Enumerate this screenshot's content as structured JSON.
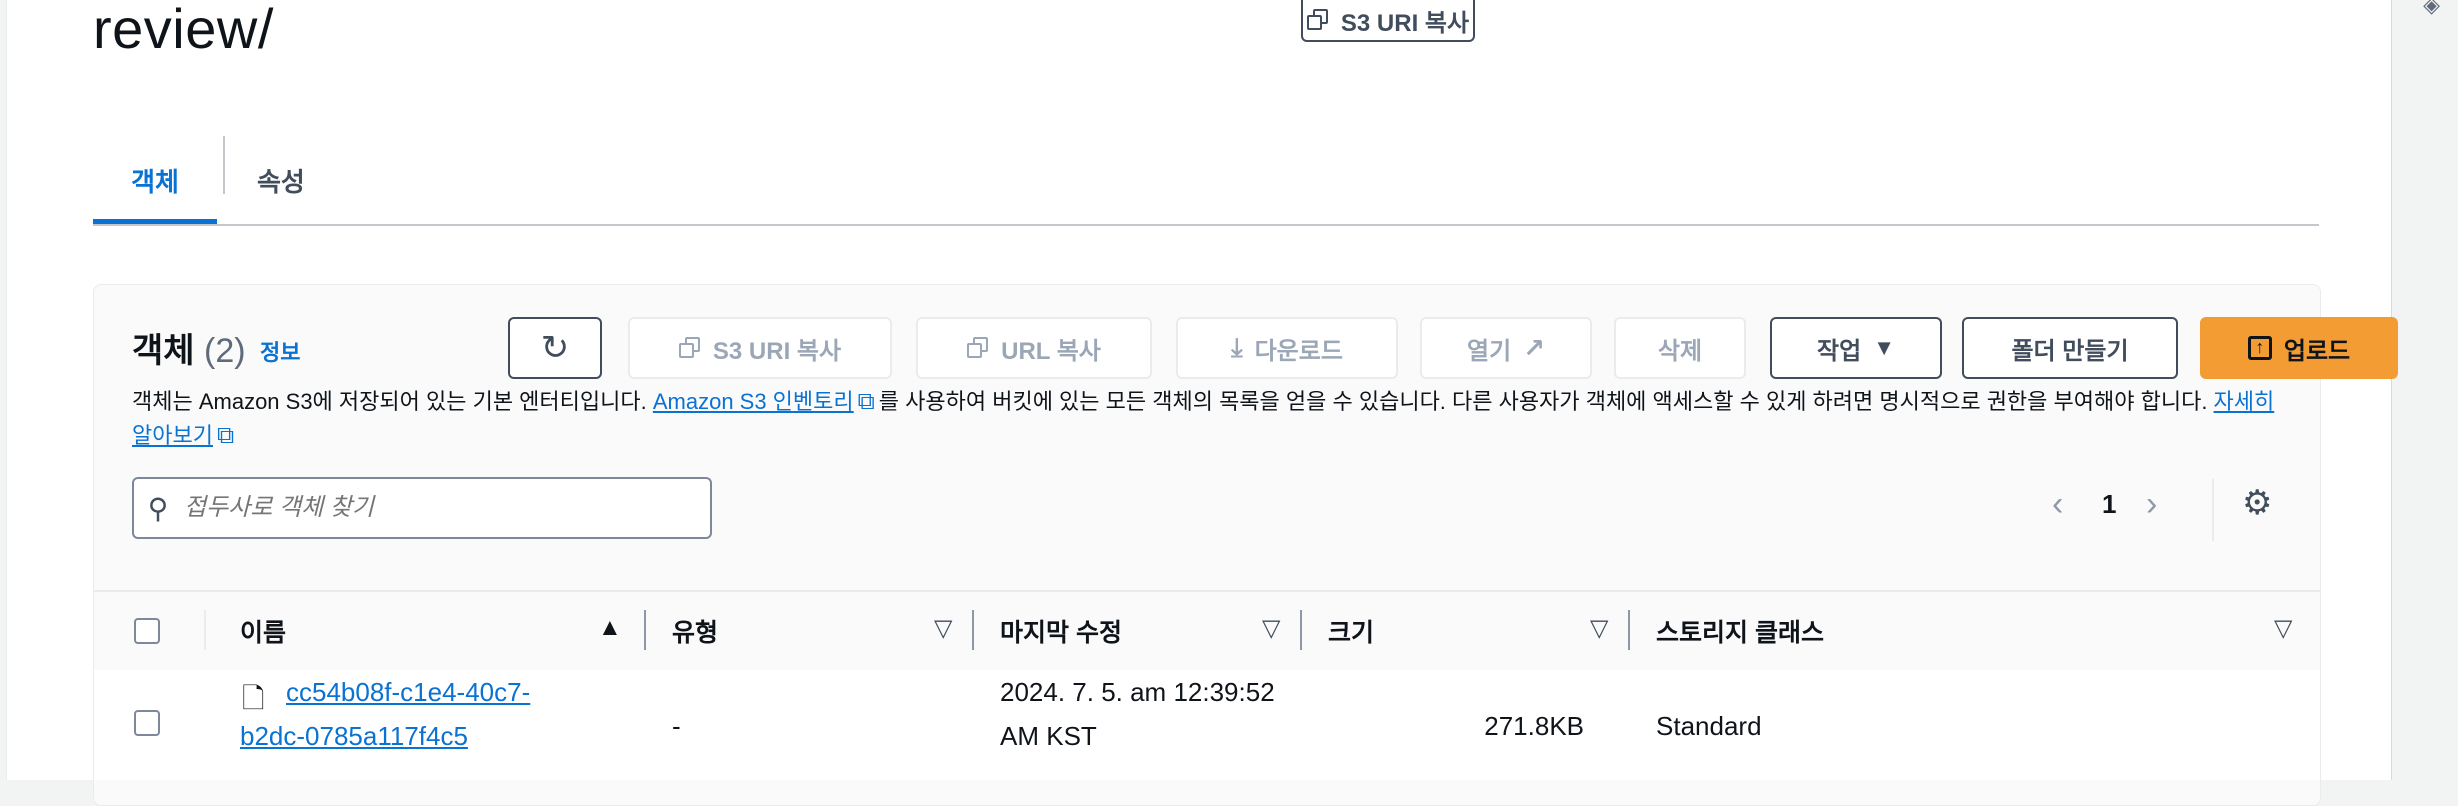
{
  "header": {
    "title": "review/",
    "copy_s3_uri_label": "S3 URI 복사"
  },
  "tabs": [
    {
      "label": "객체"
    },
    {
      "label": "속성"
    }
  ],
  "objects_panel": {
    "heading": "객체",
    "count": "(2)",
    "info_link": "정보",
    "toolbar": {
      "refresh_icon": "refresh-icon",
      "copy_s3_uri": "S3 URI 복사",
      "copy_url": "URL 복사",
      "download": "다운로드",
      "open": "열기",
      "delete": "삭제",
      "actions": "작업",
      "create_folder": "폴더 만들기",
      "upload": "업로드"
    },
    "description": {
      "part1": "객체는 Amazon S3에 저장되어 있는 기본 엔터티입니다. ",
      "inventory_link": "Amazon S3 인벤토리",
      "part2": "를 사용하여 버킷에 있는 모든 객체의 목록을 얻을 수 있습니다. 다른 사용자가 객체에 액세스할 수 있게 하려면 명시적으로 권한을 부여해야 합니다. ",
      "learn_more": "자세히 알아보기"
    },
    "search": {
      "placeholder": "접두사로 객체 찾기"
    },
    "pagination": {
      "current_page": "1"
    },
    "table": {
      "columns": [
        "이름",
        "유형",
        "마지막 수정",
        "크기",
        "스토리지 클래스"
      ],
      "rows": [
        {
          "name_line1": "cc54b08f-c1e4-40c7-",
          "name_line2": "b2dc-0785a117f4c5",
          "type": "-",
          "modified_line1": "2024. 7. 5. am 12:39:52",
          "modified_line2": "AM KST",
          "size": "271.8KB",
          "storage_class": "Standard"
        }
      ]
    }
  },
  "colors": {
    "accent": "#0972d3",
    "primary_button": "#f39c34",
    "border": "#414d5c"
  }
}
